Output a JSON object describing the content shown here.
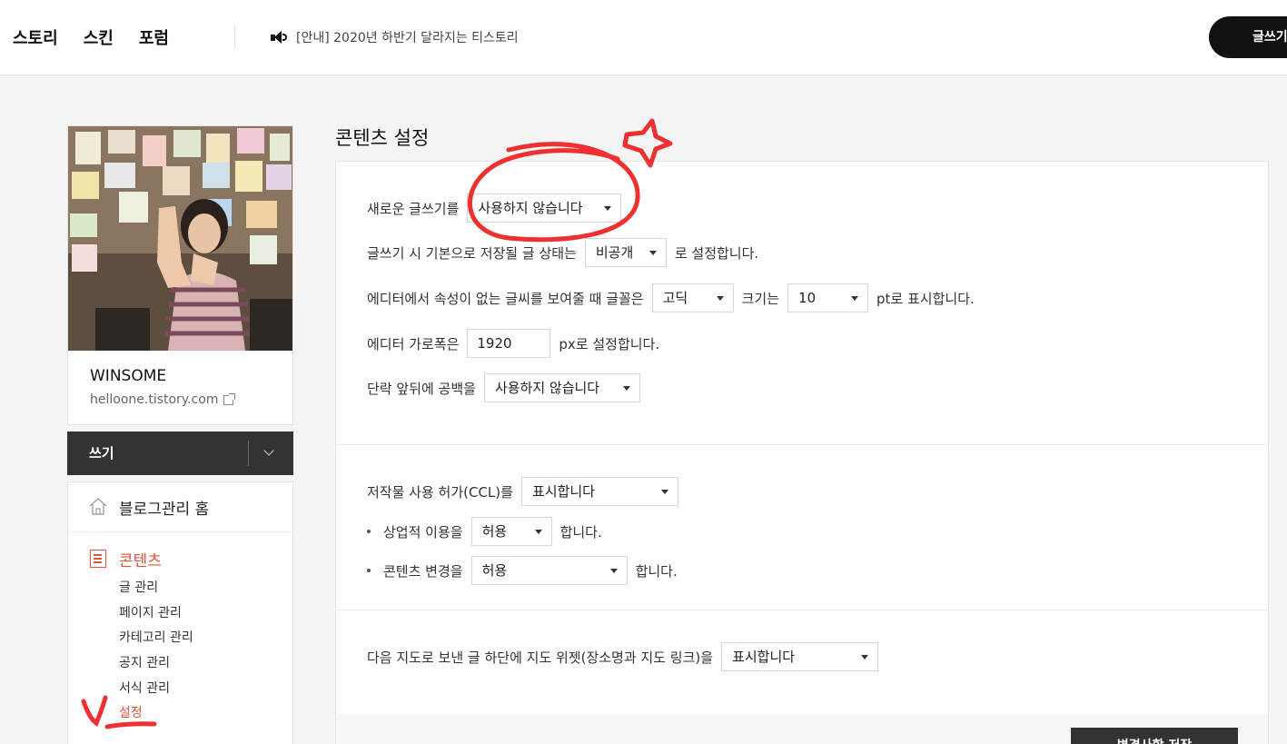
{
  "topbar": {
    "nav": [
      "스토리",
      "스킨",
      "포럼"
    ],
    "notice": "[안내] 2020년 하반기 달라지는 티스토리",
    "write_button": "글쓰기"
  },
  "profile": {
    "name": "WINSOME",
    "url": "helloone.tistory.com"
  },
  "write_bar": {
    "label": "쓰기"
  },
  "menu": {
    "home": "블로그관리 홈",
    "section": "콘텐츠",
    "items": [
      "글 관리",
      "페이지 관리",
      "카테고리 관리",
      "공지 관리",
      "서식 관리",
      "설정"
    ]
  },
  "page_title": "콘텐츠 설정",
  "editor": {
    "new_editor_label": "새로운 글쓰기를",
    "new_editor_value": "사용하지 않습니다",
    "default_state_label": "글쓰기 시 기본으로 저장될 글 상태는",
    "default_state_value": "비공개",
    "default_state_suffix": "로 설정합니다.",
    "font_label": "에디터에서 속성이 없는 글씨를 보여줄 때 글꼴은",
    "font_value": "고딕",
    "size_label": "크기는",
    "size_value": "10",
    "size_suffix": "pt로 표시합니다.",
    "width_label": "에디터 가로폭은",
    "width_value": "1920",
    "width_suffix": "px로 설정합니다.",
    "para_label": "단락 앞뒤에 공백을",
    "para_value": "사용하지 않습니다"
  },
  "ccl": {
    "label": "저작물 사용 허가(CCL)를",
    "value": "표시합니다",
    "commercial_label": "상업적 이용을",
    "commercial_value": "허용",
    "commercial_suffix": "합니다.",
    "modify_label": "콘텐츠 변경을",
    "modify_value": "허용",
    "modify_suffix": "합니다."
  },
  "map": {
    "label": "다음 지도로 보낸 글 하단에 지도 위젯(장소명과 지도 링크)을",
    "value": "표시합니다"
  },
  "save_button": "변경사항 저장",
  "colors": {
    "accent": "#e0533b",
    "dark": "#333333",
    "marker": "#ee3030"
  }
}
